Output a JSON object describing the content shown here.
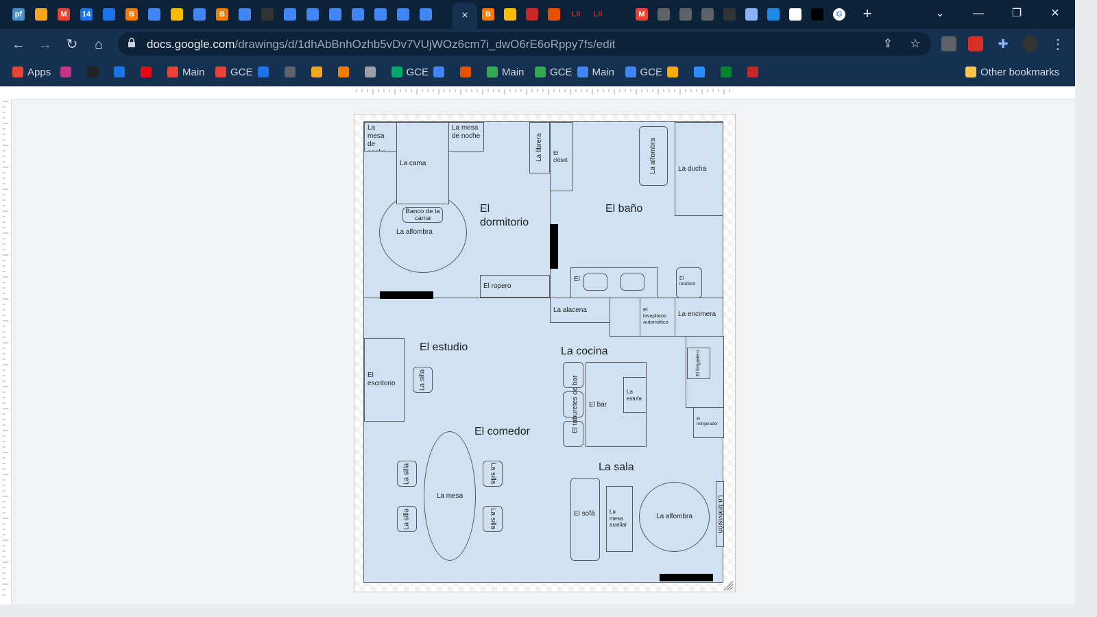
{
  "browser": {
    "active_tab_close": "×",
    "new_tab": "+",
    "url_host": "docs.google.com",
    "url_path": "/drawings/d/1dhAbBnhOzhb5vDv7VUjWOz6cm7i_dwO6rE6oRppy7fs/edit",
    "tab_icons": [
      {
        "label": "pf",
        "color": "#4a90c8"
      },
      {
        "label": "",
        "color": "#f5a623"
      },
      {
        "label": "M",
        "color": "#ea4335"
      },
      {
        "label": "14",
        "color": "#1a73e8"
      },
      {
        "label": "",
        "color": "#1a73e8"
      },
      {
        "label": "B",
        "color": "#f57c00"
      },
      {
        "label": "",
        "color": "#4285f4"
      },
      {
        "label": "",
        "color": "#fbbc04"
      },
      {
        "label": "",
        "color": "#4285f4"
      },
      {
        "label": "B",
        "color": "#f57c00"
      },
      {
        "label": "",
        "color": "#4285f4"
      },
      {
        "label": "",
        "color": "#333"
      },
      {
        "label": "",
        "color": "#4285f4"
      },
      {
        "label": "",
        "color": "#4285f4"
      },
      {
        "label": "",
        "color": "#4285f4"
      },
      {
        "label": "",
        "color": "#4285f4"
      },
      {
        "label": "",
        "color": "#4285f4"
      },
      {
        "label": "",
        "color": "#4285f4"
      },
      {
        "label": "",
        "color": "#4285f4"
      }
    ],
    "tab_icons_right": [
      {
        "label": "B",
        "color": "#f57c00"
      },
      {
        "label": "",
        "color": "#fbbc04"
      },
      {
        "label": "",
        "color": "#c62828"
      },
      {
        "label": "",
        "color": "#e65100"
      },
      {
        "label": "LII",
        "color": "transparent"
      },
      {
        "label": "LII",
        "color": "transparent"
      },
      {
        "label": "",
        "color": "transparent"
      },
      {
        "label": "M",
        "color": "#ea4335"
      },
      {
        "label": "",
        "color": "#5f6368"
      },
      {
        "label": "",
        "color": "#5f6368"
      },
      {
        "label": "",
        "color": "#5f6368"
      },
      {
        "label": "",
        "color": "#333"
      },
      {
        "label": "",
        "color": "#8ab4f8"
      },
      {
        "label": "",
        "color": "#1e88e5"
      },
      {
        "label": "",
        "color": "#fff"
      },
      {
        "label": "",
        "color": "#000"
      },
      {
        "label": "G",
        "color": "#fff"
      }
    ]
  },
  "bookmarks": [
    {
      "label": "Apps",
      "color": "#ea4335"
    },
    {
      "label": "",
      "color": "#c13584"
    },
    {
      "label": "",
      "color": "#222"
    },
    {
      "label": "",
      "color": "#1a73e8"
    },
    {
      "label": "",
      "color": "#e50914"
    },
    {
      "label": "Main",
      "color": "#ea4335"
    },
    {
      "label": "GCE",
      "color": "#ea4335"
    },
    {
      "label": "",
      "color": "#1a73e8"
    },
    {
      "label": "",
      "color": "#5f6368"
    },
    {
      "label": "",
      "color": "#f5a623"
    },
    {
      "label": "",
      "color": "#f57c00"
    },
    {
      "label": "",
      "color": "#9aa0a6"
    },
    {
      "label": "GCE",
      "color": "#00a86b"
    },
    {
      "label": "",
      "color": "#4285f4"
    },
    {
      "label": "",
      "color": "#e65100"
    },
    {
      "label": "Main",
      "color": "#34a853"
    },
    {
      "label": "GCE",
      "color": "#34a853"
    },
    {
      "label": "Main",
      "color": "#4285f4"
    },
    {
      "label": "GCE",
      "color": "#4285f4"
    },
    {
      "label": "",
      "color": "#f9ab00"
    },
    {
      "label": "",
      "color": "#2d8cff"
    },
    {
      "label": "",
      "color": "#00832d"
    },
    {
      "label": "",
      "color": "#c62828"
    }
  ],
  "other_bookmarks": "Other bookmarks",
  "plan": {
    "rooms": {
      "dormitorio": "El dormitorio",
      "bano": "El baño",
      "estudio": "El estudio",
      "cocina": "La cocina",
      "comedor": "El comedor",
      "sala": "La sala"
    },
    "items": {
      "mesa_noche_1": "La mesa de noche",
      "cama": "La cama",
      "mesa_noche_2": "La mesa de noche",
      "librera": "La librera",
      "closet": "El clóset",
      "alfombra_bano": "La alfombra",
      "ducha": "La ducha",
      "banco": "Banco de la cama",
      "alfombra_dorm": "La alfombra",
      "ropero": "El ropero",
      "lavamos": "El lavamos",
      "inodoro": "El inodoro",
      "alacena": "La alacena",
      "lavaplatos": "El lavaplatos automático",
      "encimera": "La encimera",
      "escritorio": "El escritorio",
      "silla_estudio": "La silla",
      "taburetes": "El taburetes de bar",
      "bar": "El bar",
      "estufa": "La estufa",
      "fregadero": "El fregadero",
      "refrigerador": "El refrigerador",
      "silla_1": "La silla",
      "silla_2": "La silla",
      "silla_3": "La silla",
      "silla_4": "La silla",
      "mesa": "La mesa",
      "sofa": "El sofá",
      "mesa_auxiliar": "La mesa auxiliar",
      "alfombra_sala": "La alfombra",
      "television": "La televisión"
    }
  }
}
